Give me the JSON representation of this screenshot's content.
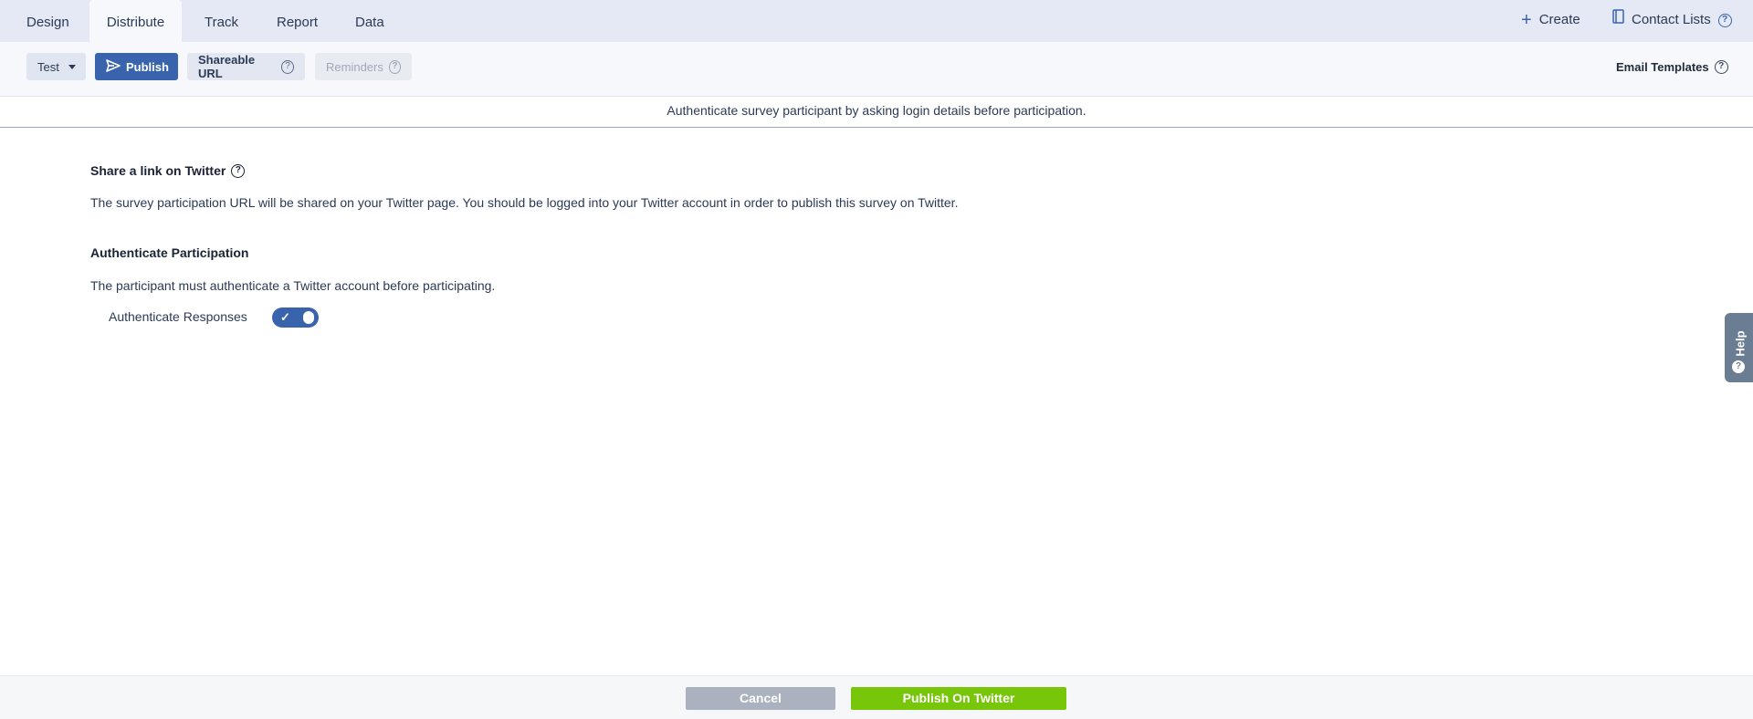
{
  "tabs": [
    {
      "label": "Design"
    },
    {
      "label": "Distribute",
      "active": true
    },
    {
      "label": "Track"
    },
    {
      "label": "Report"
    },
    {
      "label": "Data"
    }
  ],
  "header_right": {
    "create_label": "Create",
    "create_icon": "plus-icon",
    "contact_lists_label": "Contact Lists",
    "contact_lists_icon": "book-icon"
  },
  "toolbar": {
    "test_label": "Test",
    "publish_label": "Publish",
    "publish_icon": "send-icon",
    "shareable_url_label": "Shareable URL",
    "reminders_label": "Reminders",
    "email_templates_label": "Email Templates"
  },
  "banner": {
    "text": "Authenticate survey participant by asking login details before participation."
  },
  "section_share": {
    "title": "Share a link on Twitter",
    "description": "The survey participation URL will be shared on your Twitter page. You should be logged into your Twitter account in order to publish this survey on Twitter."
  },
  "section_auth": {
    "title": "Authenticate Participation",
    "description": "The participant must authenticate a Twitter account before participating.",
    "toggle_label": "Authenticate Responses",
    "toggle_on": true
  },
  "help_tab": {
    "label": "Help"
  },
  "footer": {
    "cancel_label": "Cancel",
    "publish_label": "Publish On Twitter"
  },
  "colors": {
    "primary": "#3964ad",
    "publish_green": "#77c60a",
    "cancel_gray": "#a9b2be",
    "tabbar_bg": "#e4e9f5"
  }
}
